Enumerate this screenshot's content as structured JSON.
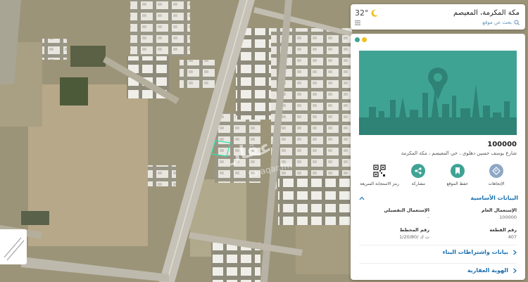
{
  "search_bar": {
    "city": "مكة المكرمة، المعيصم",
    "search_label": "بحث عن موقع",
    "temperature": "32°"
  },
  "listing": {
    "price": "100000",
    "address": "شارع يوسف حسين دهلوي ، حي المعيصم ، مكة المكرمة"
  },
  "actions": [
    {
      "label": "الإتجاهات",
      "icon": "directions-icon",
      "color": "#8da7c4"
    },
    {
      "label": "حفظ الموقع",
      "icon": "bookmark-icon",
      "color": "#3fa394"
    },
    {
      "label": "مشاركة",
      "icon": "share-icon",
      "color": "#3fa394"
    },
    {
      "label": "رمز الاستجابة السريعة",
      "icon": "qr-code-icon",
      "color": "#333333"
    }
  ],
  "basic_info": {
    "title": "البيانات الأساسية",
    "fields": [
      {
        "label": "الإستعمال العام",
        "value": "100000"
      },
      {
        "label": "الإستعمال التفصيلي",
        "value": "-"
      },
      {
        "label": "رقم القطعة",
        "value": "407"
      },
      {
        "label": "رقم المخطط",
        "value": "ت ك /1/20/80"
      }
    ]
  },
  "sections": {
    "building": "بيانات واشتراطات البناء",
    "identity": "الهوية العقارية"
  },
  "watermark": {
    "logo": "عقار",
    "url": "sa.aqar.fm"
  },
  "colors": {
    "accent": "#3fa394",
    "link": "#1a6fb0",
    "dot_green": "#3fa394",
    "dot_yellow": "#f0c020"
  }
}
